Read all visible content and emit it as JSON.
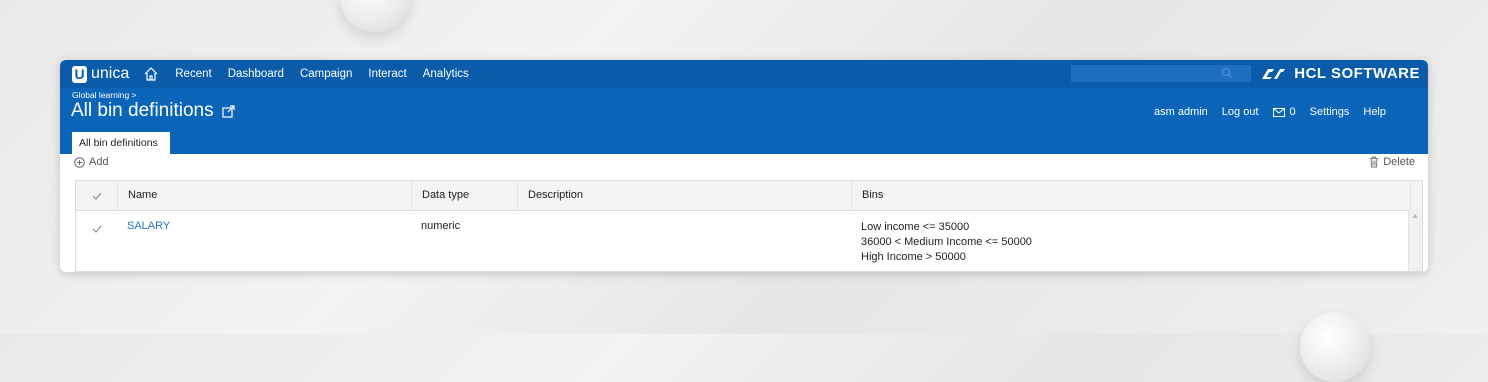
{
  "app": {
    "logo_mark": "U",
    "logo_text": "unica",
    "nav": [
      "Recent",
      "Dashboard",
      "Campaign",
      "Interact",
      "Analytics"
    ],
    "search_placeholder": "",
    "brand": "HCL SOFTWARE"
  },
  "header": {
    "breadcrumb": "Global learning >",
    "title": "All bin definitions",
    "user": "asm admin",
    "logout": "Log out",
    "mail_count": "0",
    "settings": "Settings",
    "help": "Help",
    "tab": "All bin definitions"
  },
  "toolbar": {
    "add": "Add",
    "delete": "Delete"
  },
  "table": {
    "columns": [
      "Name",
      "Data type",
      "Description",
      "Bins"
    ],
    "rows": [
      {
        "name": "SALARY",
        "data_type": "numeric",
        "description": "",
        "bins": [
          "Low income <= 35000",
          "36000 < Medium Income <= 50000",
          "High Income > 50000"
        ]
      }
    ]
  },
  "colors": {
    "topbar": "#0a5cab",
    "header": "#0a64b8",
    "link": "#2d73bf"
  }
}
